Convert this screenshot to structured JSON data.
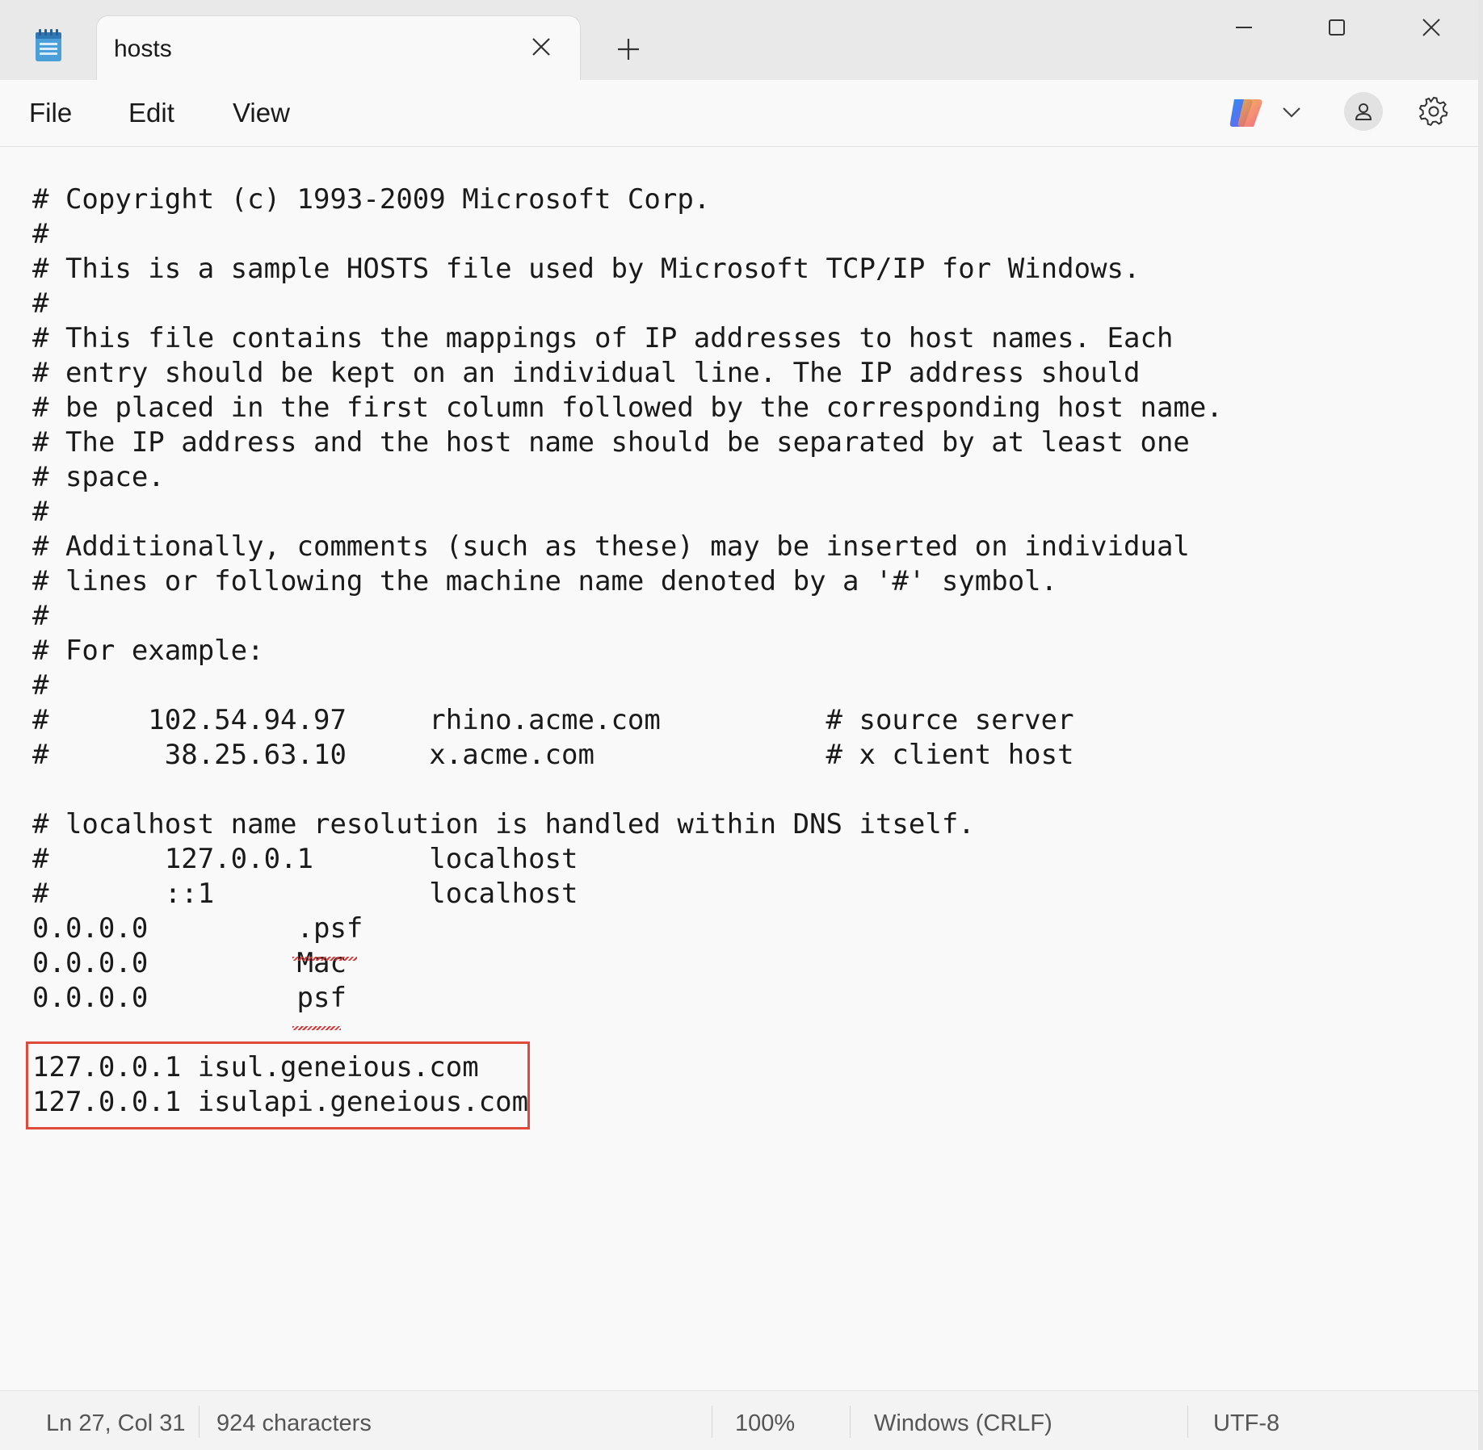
{
  "titlebar": {
    "tab_title": "hosts",
    "new_tab_symbol": "+",
    "app_icon": "notepad-icon",
    "controls": [
      "minimize-icon",
      "maximize-icon",
      "close-icon"
    ]
  },
  "menubar": {
    "items": [
      "File",
      "Edit",
      "View"
    ],
    "icons": [
      "copilot-icon",
      "chevron-down-icon",
      "account-icon",
      "gear-icon"
    ]
  },
  "editor": {
    "lines": [
      "# Copyright (c) 1993-2009 Microsoft Corp.",
      "#",
      "# This is a sample HOSTS file used by Microsoft TCP/IP for Windows.",
      "#",
      "# This file contains the mappings of IP addresses to host names. Each",
      "# entry should be kept on an individual line. The IP address should",
      "# be placed in the first column followed by the corresponding host name.",
      "# The IP address and the host name should be separated by at least one",
      "# space.",
      "#",
      "# Additionally, comments (such as these) may be inserted on individual",
      "# lines or following the machine name denoted by a '#' symbol.",
      "#",
      "# For example:",
      "#",
      "#      102.54.94.97     rhino.acme.com          # source server",
      "#       38.25.63.10     x.acme.com              # x client host",
      "",
      "# localhost name resolution is handled within DNS itself.",
      "#       127.0.0.1       localhost",
      "#       ::1             localhost",
      "0.0.0.0         .psf",
      "0.0.0.0         Mac",
      "0.0.0.0         psf",
      "",
      "127.0.0.1 isul.geneious.com",
      "127.0.0.1 isulapi.geneious.com"
    ]
  },
  "statusbar": {
    "position": "Ln 27, Col 31",
    "characters": "924 characters",
    "zoom": "100%",
    "line_ending": "Windows (CRLF)",
    "encoding": "UTF-8"
  },
  "colors": {
    "highlight_border": "#e04a3a",
    "spellcheck": "#dd3333"
  }
}
